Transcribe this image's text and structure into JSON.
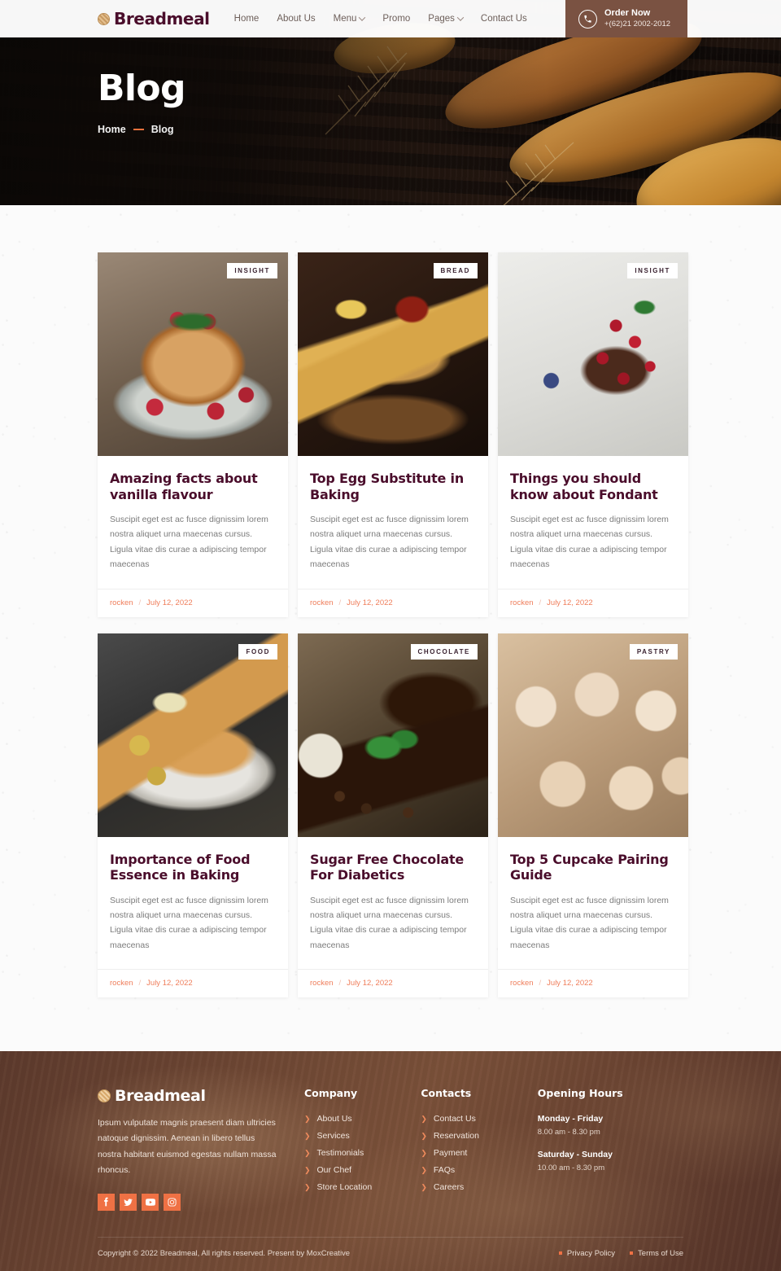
{
  "header": {
    "logo_text": "Breadmeal",
    "nav": [
      {
        "label": "Home",
        "has_dropdown": false
      },
      {
        "label": "About Us",
        "has_dropdown": false
      },
      {
        "label": "Menu",
        "has_dropdown": true
      },
      {
        "label": "Promo",
        "has_dropdown": false
      },
      {
        "label": "Pages",
        "has_dropdown": true
      },
      {
        "label": "Contact Us",
        "has_dropdown": false
      }
    ],
    "order": {
      "title": "Order Now",
      "phone": "+(62)21 2002-2012",
      "icon": "phone-icon",
      "bg_color": "#7a5242"
    }
  },
  "hero": {
    "title": "Blog",
    "breadcrumb": {
      "home": "Home",
      "separator": "—",
      "current": "Blog"
    }
  },
  "blog": {
    "posts": [
      {
        "badge": "INSIGHT",
        "title": "Amazing facts about vanilla flavour",
        "excerpt": "Suscipit eget est ac fusce dignissim lorem nostra aliquet urna maecenas cursus. Ligula vitae dis curae a adipiscing tempor maecenas",
        "author": "rocken",
        "separator": "/",
        "date": "July 12, 2022",
        "image": "pancakes-with-raspberries"
      },
      {
        "badge": "BREAD",
        "title": "Top Egg Substitute in Baking",
        "excerpt": "Suscipit eget est ac fusce dignissim lorem nostra aliquet urna maecenas cursus. Ligula vitae dis curae a adipiscing tempor maecenas",
        "author": "rocken",
        "separator": "/",
        "date": "July 12, 2022",
        "image": "fried-sticks-with-dipping-sauce"
      },
      {
        "badge": "INSIGHT",
        "title": "Things you should know about Fondant",
        "excerpt": "Suscipit eget est ac fusce dignissim lorem nostra aliquet urna maecenas cursus. Ligula vitae dis curae a adipiscing tempor maecenas",
        "author": "rocken",
        "separator": "/",
        "date": "July 12, 2022",
        "image": "chocolate-cake-with-berries"
      },
      {
        "badge": "FOOD",
        "title": "Importance of Food Essence in Baking",
        "excerpt": "Suscipit eget est ac fusce dignissim lorem nostra aliquet urna maecenas cursus. Ligula vitae dis curae a adipiscing tempor maecenas",
        "author": "rocken",
        "separator": "/",
        "date": "July 12, 2022",
        "image": "schnitzel-with-potatoes"
      },
      {
        "badge": "CHOCOLATE",
        "title": "Sugar Free Chocolate For Diabetics",
        "excerpt": "Suscipit eget est ac fusce dignissim lorem nostra aliquet urna maecenas cursus. Ligula vitae dis curae a adipiscing tempor maecenas",
        "author": "rocken",
        "separator": "/",
        "date": "July 12, 2022",
        "image": "dark-chocolate-with-coffee-beans"
      },
      {
        "badge": "PASTRY",
        "title": "Top 5 Cupcake Pairing Guide",
        "excerpt": "Suscipit eget est ac fusce dignissim lorem nostra aliquet urna maecenas cursus. Ligula vitae dis curae a adipiscing tempor maecenas",
        "author": "rocken",
        "separator": "/",
        "date": "July 12, 2022",
        "image": "frosted-cupcakes"
      }
    ]
  },
  "footer": {
    "logo_text": "Breadmeal",
    "description": "Ipsum vulputate magnis praesent diam ultricies natoque dignissim. Aenean in libero tellus nostra habitant euismod egestas nullam massa rhoncus.",
    "socials": [
      {
        "name": "facebook-icon",
        "glyph": "f"
      },
      {
        "name": "twitter-icon",
        "glyph": "t"
      },
      {
        "name": "youtube-icon",
        "glyph": "y"
      },
      {
        "name": "instagram-icon",
        "glyph": "i"
      }
    ],
    "company": {
      "heading": "Company",
      "links": [
        "About Us",
        "Services",
        "Testimonials",
        "Our Chef",
        "Store Location"
      ]
    },
    "contacts": {
      "heading": "Contacts",
      "links": [
        "Contact Us",
        "Reservation",
        "Payment",
        "FAQs",
        "Careers"
      ]
    },
    "hours": {
      "heading": "Opening Hours",
      "blocks": [
        {
          "days": "Monday - Friday",
          "time": "8.00 am - 8.30 pm"
        },
        {
          "days": "Saturday - Sunday",
          "time": "10.00 am - 8.30 pm"
        }
      ]
    },
    "copyright": "Copyright © 2022 Breadmeal, All rights reserved. Present by MoxCreative",
    "legal": [
      "Privacy Policy",
      "Terms of Use"
    ],
    "accent_color": "#ef7144",
    "bg_color": "#6b4434"
  }
}
